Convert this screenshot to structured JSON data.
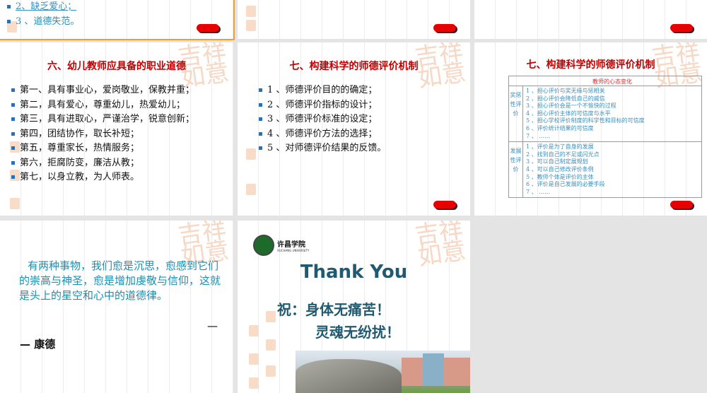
{
  "slides": {
    "s1": {
      "items": [
        "2、缺乏爱心；",
        "3 、道德失范。"
      ]
    },
    "s4": {
      "title": "六、幼儿教师应具备的职业道德",
      "items": [
        "第一、具有事业心，爱岗敬业，保教并重；",
        "第二，具有爱心，尊重幼儿，热爱幼儿；",
        "第三，具有进取心，严谨治学，锐意创新；",
        "第四，团结协作，取长补短；",
        "第五，尊重家长，热情服务；",
        "第六，拒腐防变，廉洁从教；",
        "第七，以身立教，为人师表。"
      ]
    },
    "s5": {
      "title": "七、构建科学的师德评价机制",
      "items": [
        "1 、师德评价目的的确定；",
        "2 、师德评价指标的设计；",
        "3 、师德评价标准的设定；",
        "4 、师德评价方法的选择；",
        "5 、对师德评价结果的反馈。"
      ]
    },
    "s6": {
      "title": "七、构建科学的师德评价机制",
      "table_header": "教师的心态变化",
      "rows": [
        {
          "label": "奖惩性评价",
          "items": [
            "1 、担心评价与奖无缘与惩相关",
            "2 、担心评价会降低自己的威信",
            "3 、担心评价会是一个不愉快的过程",
            "4 、担心评价主体的可信度与水平",
            "5 、担心学校评价制度的科学性和目标的可信度",
            "6 、评价统计结果的可信度",
            "7 、 ……"
          ]
        },
        {
          "label": "发展性评价",
          "items": [
            "1 、评价是为了自身的发展",
            "2 、找到自己的不足或闪光点",
            "3 、可以自己制定展规划",
            "4 、可以自己修改评价条例",
            "5 、教师个体是评价的主体",
            "6 、评价是自己发展的必要手段",
            "7 、 ……"
          ]
        }
      ]
    },
    "s7": {
      "quote": "有两种事物，我们愈是沉思，愈感到它们的崇高与神圣，愈是增加虔敬与信仰，这就是头上的星空和心中的道德律。",
      "dash": "—",
      "author": "— 康德"
    },
    "s8": {
      "logo_cn": "许昌学院",
      "logo_en": "XUCHANG UNIVERSITY",
      "thanks": "Thank You",
      "line1": "祝：身体无痛苦！",
      "line2": "灵魂无纷扰！"
    }
  },
  "decoration": "吉祥如意",
  "colors": {
    "title": "#c00000",
    "teal": "#1f5a70",
    "accent": "#e80000",
    "bullet": "#2b6fb5"
  }
}
